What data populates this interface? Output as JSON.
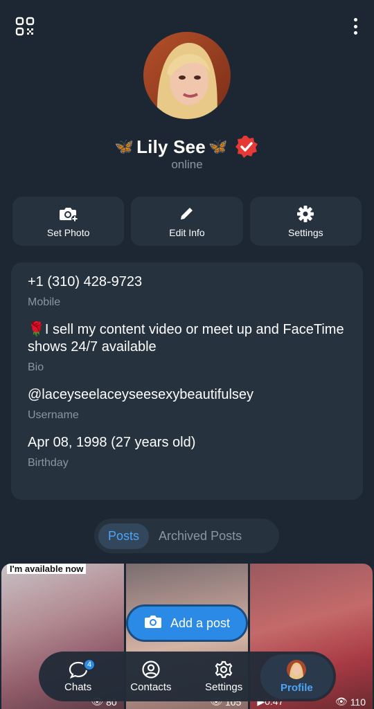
{
  "profile": {
    "name": "Lily See",
    "status": "online",
    "emoji_left": "🦋",
    "emoji_right": "🦋"
  },
  "actions": [
    {
      "label": "Set Photo",
      "icon": "camera-add-icon"
    },
    {
      "label": "Edit Info",
      "icon": "pencil-icon"
    },
    {
      "label": "Settings",
      "icon": "gear-icon"
    }
  ],
  "info": {
    "phone": "+1 (310) 428-9723",
    "phone_label": "Mobile",
    "bio": "🌹I sell my content video or meet up and FaceTime shows 24/7 available",
    "bio_label": "Bio",
    "username": "@laceyseelaceyseesexybeautifulsey",
    "username_label": "Username",
    "birthday": "Apr 08, 1998 (27 years old)",
    "birthday_label": "Birthday"
  },
  "tabs": [
    {
      "label": "Posts",
      "active": true
    },
    {
      "label": "Archived Posts",
      "active": false
    }
  ],
  "posts": [
    {
      "caption": "I'm available now",
      "views": "80"
    },
    {
      "views": "105"
    },
    {
      "duration": "0:47",
      "views": "110"
    }
  ],
  "add_post_label": "Add a post",
  "nav": [
    {
      "label": "Chats",
      "badge": "4",
      "icon": "chat-icon"
    },
    {
      "label": "Contacts",
      "icon": "contacts-icon"
    },
    {
      "label": "Settings",
      "icon": "gear-icon"
    },
    {
      "label": "Profile",
      "icon": "avatar",
      "active": true
    }
  ],
  "colors": {
    "background": "#1d2733",
    "card": "#27323f",
    "accent": "#4ea4f6",
    "verified": "#e53935"
  }
}
